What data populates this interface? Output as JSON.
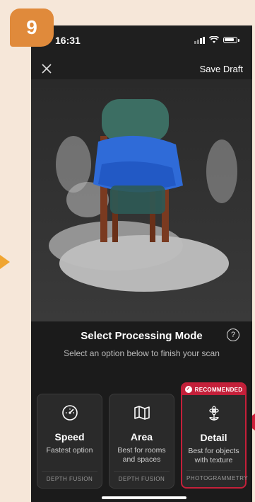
{
  "step": {
    "number": "9"
  },
  "status_bar": {
    "time": "16:31"
  },
  "nav": {
    "close_icon": "close-icon",
    "save_draft": "Save Draft"
  },
  "panel": {
    "title": "Select Processing Mode",
    "subtitle": "Select an option below to finish your scan",
    "help_label": "?"
  },
  "modes": [
    {
      "title": "Speed",
      "desc_line1": "Fastest option",
      "desc_line2": "",
      "method": "DEPTH FUSION",
      "icon": "speedometer-icon"
    },
    {
      "title": "Area",
      "desc_line1": "Best for rooms",
      "desc_line2": "and spaces",
      "method": "DEPTH FUSION",
      "icon": "map-icon"
    },
    {
      "title": "Detail",
      "desc_line1": "Best for objects",
      "desc_line2": "with texture",
      "method": "PHOTOGRAMMETRY",
      "icon": "flower-icon",
      "badge": "RECOMMENDED",
      "selected": true
    }
  ],
  "colors": {
    "accent": "#c4203a",
    "step_badge": "#e08a3b",
    "background": "#f6e7d9",
    "left_arrow": "#f0a531"
  }
}
